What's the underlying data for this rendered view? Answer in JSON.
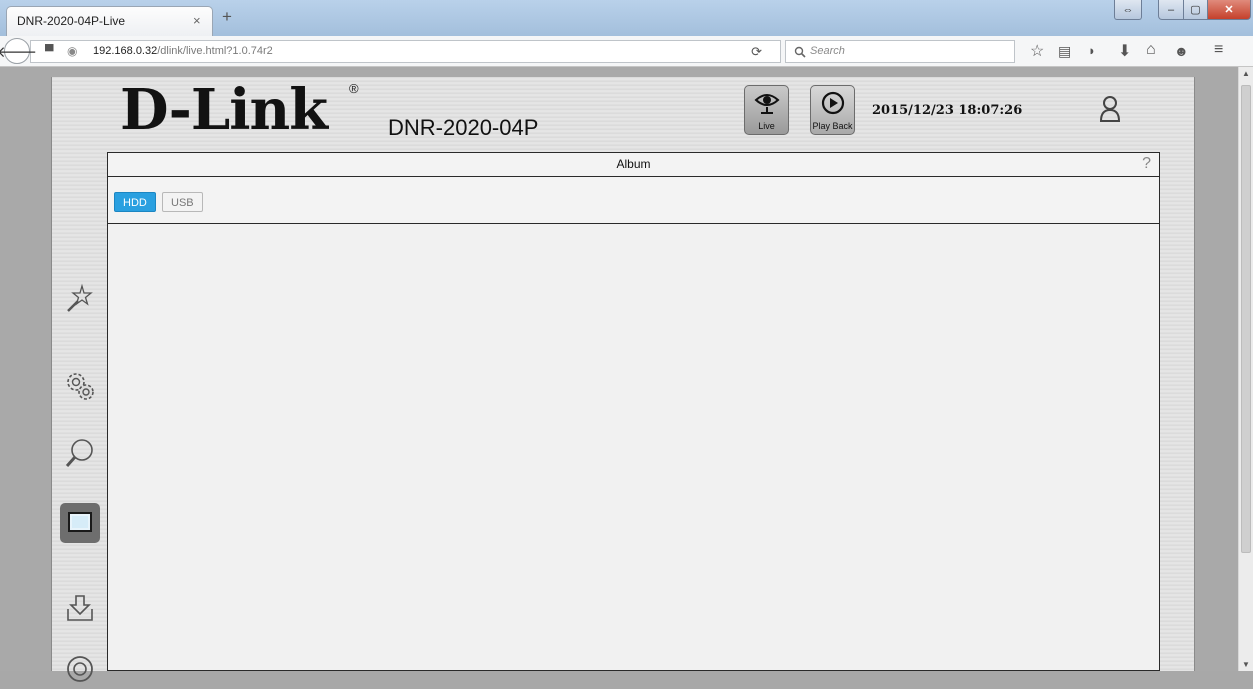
{
  "browser": {
    "tab_title": "DNR-2020-04P-Live",
    "tab_close": "×",
    "new_tab": "+",
    "url_host": "192.168.0.32",
    "url_path": "/dlink/live.html?1.0.74r2",
    "search_placeholder": "Search"
  },
  "header": {
    "logo": "D-Link",
    "reg_mark": "®",
    "model": "DNR-2020-04P",
    "nav": [
      {
        "label": "Live",
        "icon": "eye-icon"
      },
      {
        "label": "Play Back",
        "icon": "play-icon"
      }
    ],
    "datetime": "2015/12/23 18:07:26"
  },
  "sidebar": {
    "items": [
      {
        "name": "wizard",
        "icon": "magic-wand-icon",
        "active": false
      },
      {
        "name": "settings",
        "icon": "gears-icon",
        "active": false
      },
      {
        "name": "search",
        "icon": "magnifier-icon",
        "active": false
      },
      {
        "name": "album",
        "icon": "album-icon",
        "active": true
      },
      {
        "name": "download",
        "icon": "download-icon",
        "active": false
      },
      {
        "name": "about",
        "icon": "circle-icon",
        "active": false
      }
    ]
  },
  "album": {
    "title": "Album",
    "help": "?",
    "sources": [
      {
        "label": "HDD",
        "selected": true
      },
      {
        "label": "USB",
        "selected": false
      }
    ]
  },
  "colors": {
    "accent": "#2aa0e0",
    "panel": "#dedede",
    "active_sidebar": "#6e6e6e"
  }
}
